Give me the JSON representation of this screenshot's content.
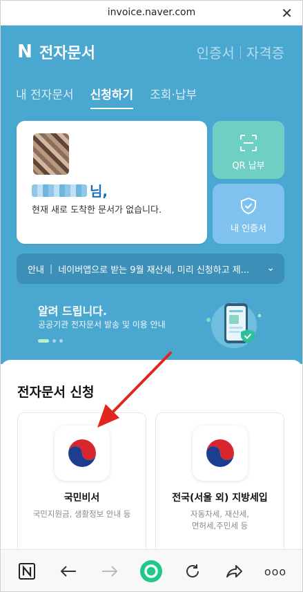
{
  "browser": {
    "url": "invoice.naver.com",
    "close_glyph": "✕"
  },
  "header": {
    "logo_letter": "N",
    "title": "전자문서",
    "links": [
      "인증서",
      "자격증"
    ]
  },
  "tabs": [
    {
      "label": "내 전자문서",
      "active": false
    },
    {
      "label": "신청하기",
      "active": true
    },
    {
      "label": "조회·납부",
      "active": false
    }
  ],
  "profile": {
    "name_suffix": "님,",
    "message": "현재 새로 도착한 문서가 없습니다."
  },
  "side_buttons": {
    "qr_label": "QR 납부",
    "cert_label": "내 인증서"
  },
  "notice": {
    "tag": "안내",
    "separator": "|",
    "text": "네이버앱으로 받는 9월 재산세, 미리 신청하고 제...",
    "chevron": "⌄"
  },
  "banner": {
    "title": "알려 드립니다.",
    "subtitle": "공공기관 전자문서 발송 및 이용 안내",
    "page_count": 3,
    "active_page": 1
  },
  "section": {
    "title": "전자문서 신청"
  },
  "services": [
    {
      "title": "국민비서",
      "desc": "국민지원금, 생활정보 안내 등"
    },
    {
      "title": "전국(서울 외) 지방세입",
      "desc": "자동차세, 재산세,\n면허세,주민세 등"
    }
  ],
  "colors": {
    "header_blue": "#4aa7cf",
    "qr_button": "#6ecfc2",
    "cert_button": "#7fc2ee",
    "arrow_red": "#e0261f"
  },
  "bottom_nav": {
    "icons": [
      "naver-home-icon",
      "back-arrow-icon",
      "forward-arrow-icon",
      "green-dot-icon",
      "refresh-icon",
      "share-icon",
      "more-icon"
    ],
    "home_letter": "N",
    "more_glyph": "ooo"
  }
}
